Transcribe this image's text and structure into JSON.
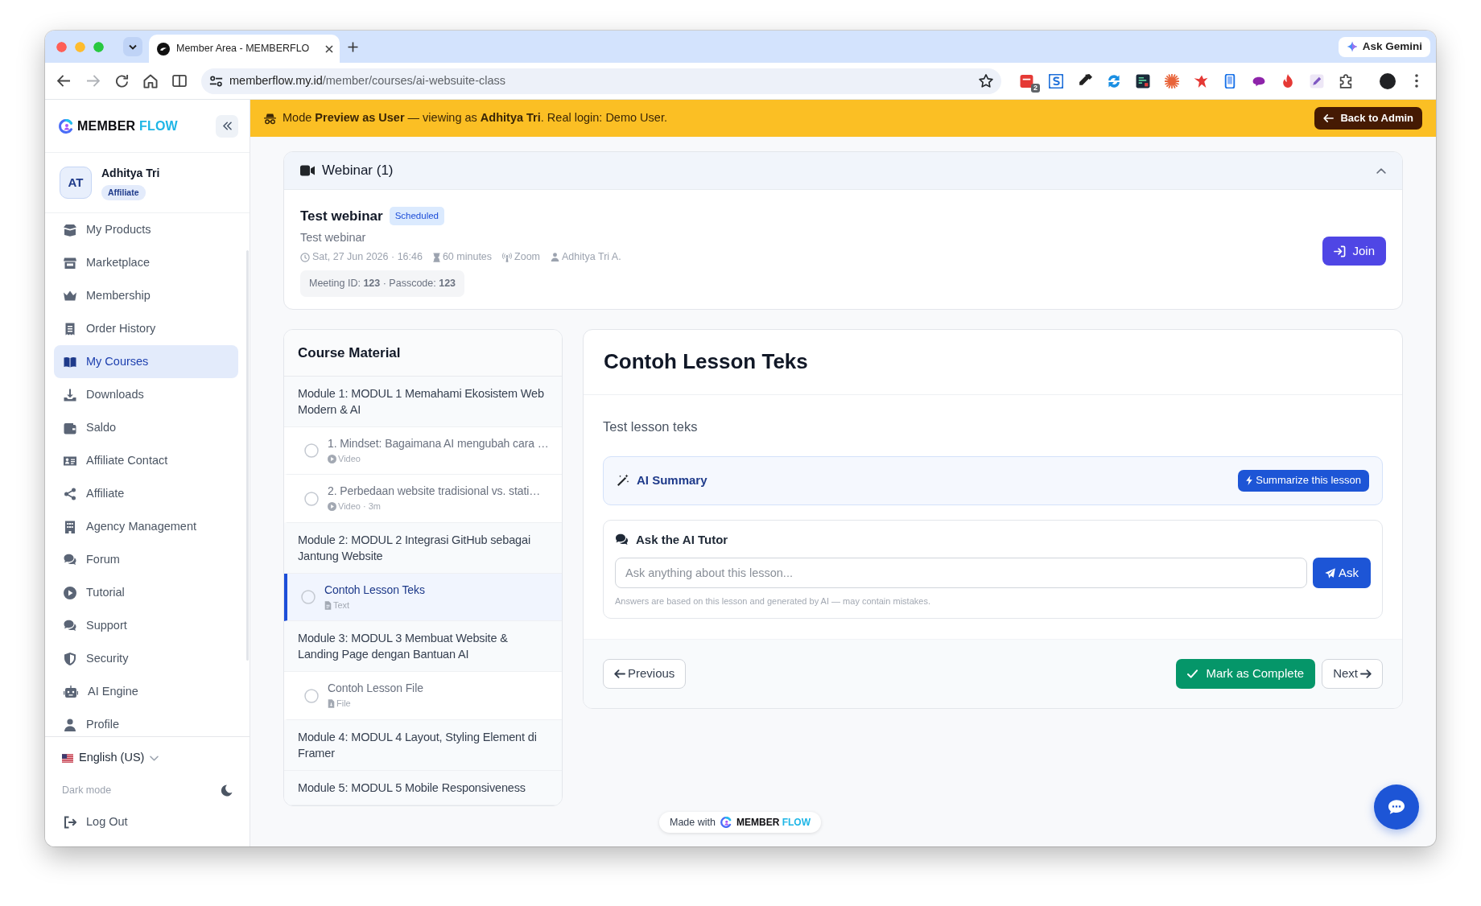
{
  "browser": {
    "tab_title": "Member Area - MEMBERFLO",
    "gemini_button": "Ask Gemini",
    "url_host": "memberflow.my.id",
    "url_path": "/member/courses/ai-websuite-class",
    "extension_badge": "2"
  },
  "sidebar": {
    "brand_word_1": "MEMBER",
    "brand_word_2": "FLOW",
    "user": {
      "initials": "AT",
      "name": "Adhitya Tri",
      "role": "Affiliate"
    },
    "items": [
      {
        "label": "My Products",
        "selected": false
      },
      {
        "label": "Marketplace",
        "selected": false
      },
      {
        "label": "Membership",
        "selected": false
      },
      {
        "label": "Order History",
        "selected": false
      },
      {
        "label": "My Courses",
        "selected": true
      },
      {
        "label": "Downloads",
        "selected": false
      },
      {
        "label": "Saldo",
        "selected": false
      },
      {
        "label": "Affiliate Contact",
        "selected": false
      },
      {
        "label": "Affiliate",
        "selected": false
      },
      {
        "label": "Agency Management",
        "selected": false
      },
      {
        "label": "Forum",
        "selected": false
      },
      {
        "label": "Tutorial",
        "selected": false
      },
      {
        "label": "Support",
        "selected": false
      },
      {
        "label": "Security",
        "selected": false
      },
      {
        "label": "AI Engine",
        "selected": false
      },
      {
        "label": "Profile",
        "selected": false
      }
    ],
    "language": "English (US)",
    "dark_mode": {
      "label": "Dark mode",
      "on": false
    },
    "logout": "Log Out"
  },
  "banner": {
    "text": "Mode **Preview as User** — viewing as **Adhitya Tri**. Real login: Demo User.",
    "button": "Back to Admin"
  },
  "webinar": {
    "title": "Webinar (1)",
    "expanded": true,
    "sessions": [
      {
        "title": "Test webinar",
        "status": "Scheduled",
        "description": "Test webinar",
        "details": [
          {
            "kind": "date",
            "text": "Sat, 27 Jun 2026 · 16:46"
          },
          {
            "kind": "duration",
            "text": "60 minutes"
          },
          {
            "kind": "platform",
            "text": "Zoom"
          },
          {
            "kind": "host",
            "text": "Adhitya Tri A."
          }
        ],
        "meeting": "Meeting ID: **123** · Passcode: **123**",
        "button": "Join"
      }
    ]
  },
  "course_material": {
    "title": "Course Material",
    "modules": [
      {
        "title": "Module 1: MODUL 1 Memahami Ekosistem Web Modern & AI",
        "lessons": [
          {
            "title": "1. Mindset: Bagaimana AI mengubah cara …",
            "kind": "video",
            "meta": "Video",
            "selected": false,
            "completed": false
          },
          {
            "title": "2. Perbedaan website tradisional vs. stati…",
            "kind": "video",
            "meta": "Video · 3m",
            "selected": false,
            "completed": false
          }
        ]
      },
      {
        "title": "Module 2: MODUL 2 Integrasi GitHub sebagai Jantung Website",
        "lessons": [
          {
            "title": "Contoh Lesson Teks",
            "kind": "text",
            "meta": "Text",
            "selected": true,
            "completed": false
          }
        ]
      },
      {
        "title": "Module 3: MODUL 3 Membuat Website & Landing Page dengan Bantuan AI",
        "lessons": [
          {
            "title": "Contoh Lesson File",
            "kind": "file",
            "meta": "File",
            "selected": false,
            "completed": false
          }
        ]
      },
      {
        "title": "Module 4: MODUL 4 Layout, Styling Element di Framer"
      },
      {
        "title": "Module 5: MODUL 5 Mobile Responsiveness"
      }
    ]
  },
  "lesson": {
    "title": "Contoh Lesson Teks",
    "body": "Test lesson teks",
    "ai_summary": {
      "title": "AI Summary",
      "button": "Summarize this lesson"
    },
    "tutor": {
      "title": "Ask the AI Tutor",
      "placeholder": "Ask anything about this lesson...",
      "button": "Ask",
      "note": "Answers are based on this lesson and generated by AI — may contain mistakes."
    },
    "previous_button": "Previous",
    "complete_button": "Mark as Complete",
    "next_button": "Next"
  },
  "made_with": {
    "label": "Made with",
    "brand_word_1": "MEMBER",
    "brand_word_2": "FLOW"
  }
}
